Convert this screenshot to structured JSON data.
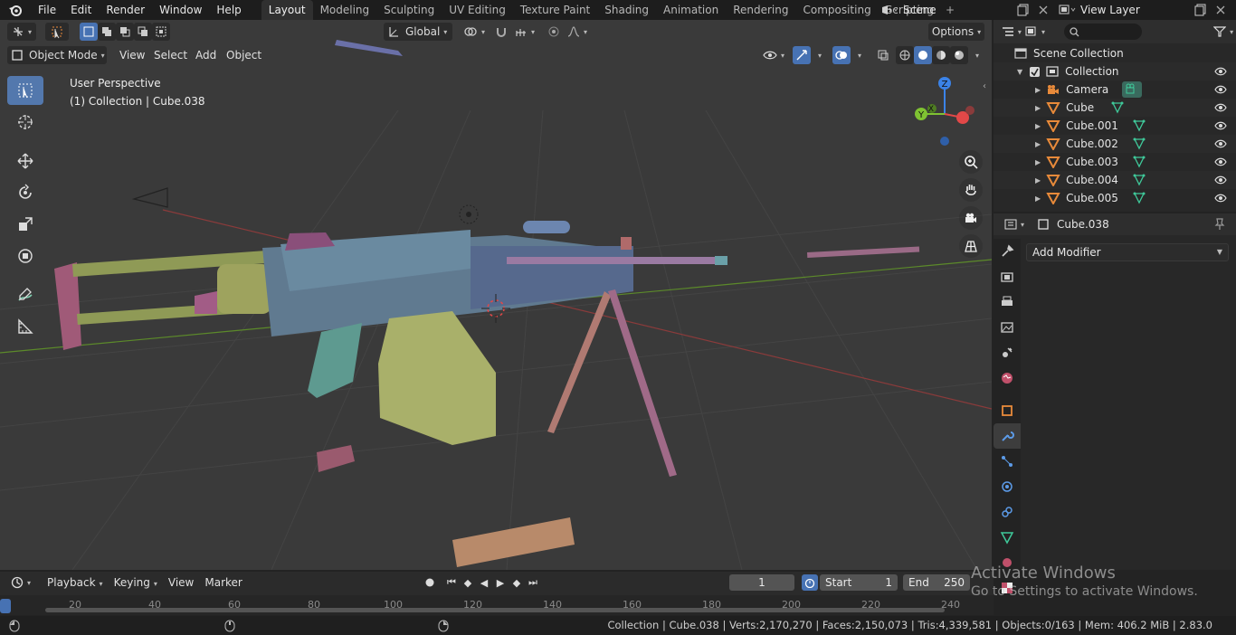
{
  "topbar": {
    "menus": [
      "File",
      "Edit",
      "Render",
      "Window",
      "Help"
    ],
    "workspaces": [
      "Layout",
      "Modeling",
      "Sculpting",
      "UV Editing",
      "Texture Paint",
      "Shading",
      "Animation",
      "Rendering",
      "Compositing",
      "Scripting"
    ],
    "active_workspace": "Layout",
    "scene": "Scene",
    "view_layer": "View Layer"
  },
  "viewport": {
    "transform_orientation": "Global",
    "options_label": "Options",
    "mode": "Object Mode",
    "header_menus": [
      "View",
      "Select",
      "Add",
      "Object"
    ],
    "perspective_label": "User Perspective",
    "context_label": "(1) Collection | Cube.038",
    "gizmo_axes": {
      "z": "Z",
      "y": "Y",
      "x": "X"
    }
  },
  "outliner": {
    "root": "Scene Collection",
    "collection": "Collection",
    "items": [
      "Camera",
      "Cube",
      "Cube.001",
      "Cube.002",
      "Cube.003",
      "Cube.004",
      "Cube.005"
    ]
  },
  "properties": {
    "object_name": "Cube.038",
    "add_modifier_label": "Add Modifier"
  },
  "timeline": {
    "menus": [
      "Playback",
      "Keying",
      "View",
      "Marker"
    ],
    "current_frame": "1",
    "start_label": "Start",
    "start_value": "1",
    "end_label": "End",
    "end_value": "250",
    "ticks": [
      "20",
      "40",
      "60",
      "80",
      "100",
      "120",
      "140",
      "160",
      "180",
      "200",
      "220",
      "240"
    ]
  },
  "status": {
    "text": "Collection | Cube.038 | Verts:2,170,270 | Faces:2,150,073 | Tris:4,339,581 | Objects:0/163 | Mem: 406.2 MiB | 2.83.0"
  },
  "watermark": {
    "line1": "Activate Windows",
    "line2": "Go to Settings to activate Windows."
  },
  "colors": {
    "accent": "#4772b3",
    "viewport_bg": "#3a3a3a",
    "mesh_icon": "#e88a3a",
    "data_icon": "#3fc99a",
    "axis_x": "#e24848",
    "axis_y": "#7fc232",
    "axis_z": "#3b83e8"
  }
}
